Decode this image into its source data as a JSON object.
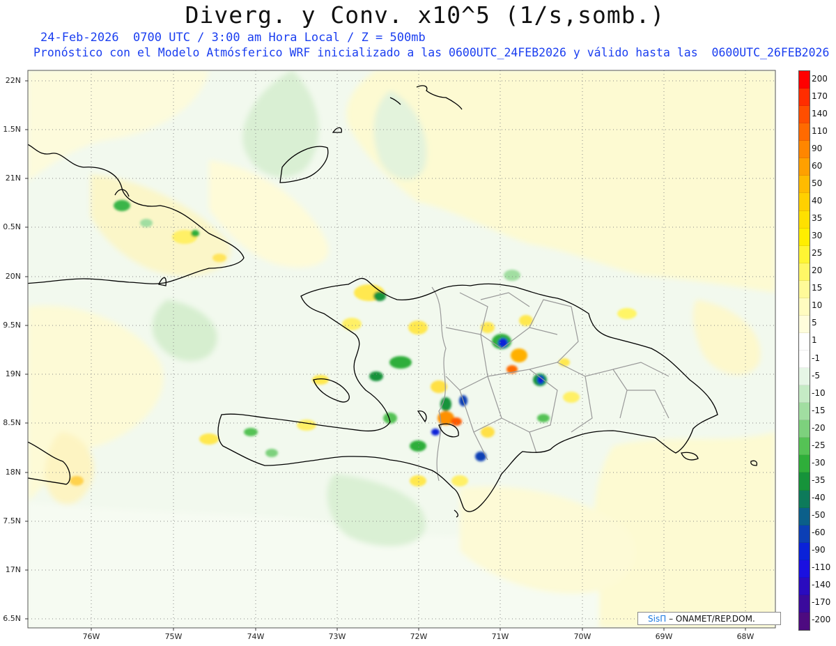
{
  "title": "Diverg. y Conv. x10^5 (1/s,somb.)",
  "subtitle_1": "24-Feb-2026  0700 UTC / 3:00 am Hora Local / Z = 500mb",
  "subtitle_2": "Pronóstico con el Modelo Atmósferico WRF inicializado a las 0600UTC_24FEB2026 y válido hasta las  0600UTC_26FEB2026",
  "lat_labels": [
    "22N",
    "1.5N",
    "21N",
    "0.5N",
    "20N",
    "9.5N",
    "19N",
    "8.5N",
    "18N",
    "7.5N",
    "17N",
    "6.5N"
  ],
  "lon_labels": [
    "76W",
    "75W",
    "74W",
    "73W",
    "72W",
    "71W",
    "70W",
    "69W",
    "68W"
  ],
  "colorbar": {
    "labels": [
      "200",
      "170",
      "140",
      "110",
      "90",
      "60",
      "50",
      "40",
      "35",
      "30",
      "25",
      "20",
      "15",
      "10",
      "5",
      "1",
      "-1",
      "-5",
      "-10",
      "-15",
      "-20",
      "-25",
      "-30",
      "-35",
      "-40",
      "-50",
      "-60",
      "-90",
      "-110",
      "-140",
      "-170",
      "-200"
    ],
    "colors": [
      "#ff0000",
      "#ff2d00",
      "#ff4e00",
      "#ff6a00",
      "#ff8600",
      "#ffa000",
      "#ffbb00",
      "#ffd000",
      "#ffe000",
      "#ffee00",
      "#fff533",
      "#fff766",
      "#fffa99",
      "#fffcc0",
      "#fffddc",
      "#ffffff",
      "#ffffff",
      "#e6f6e6",
      "#c5ebc5",
      "#a1dea1",
      "#7dd17d",
      "#55c255",
      "#2fae3a",
      "#16933a",
      "#0d7a5a",
      "#0b5f8a",
      "#0c3fb5",
      "#0a22d8",
      "#1a10e0",
      "#2a0bbf",
      "#3a0a9c",
      "#4d0a80"
    ]
  },
  "credit": {
    "sis": "SisΠ",
    "rest": "– ONAMET/REP.DOM."
  }
}
